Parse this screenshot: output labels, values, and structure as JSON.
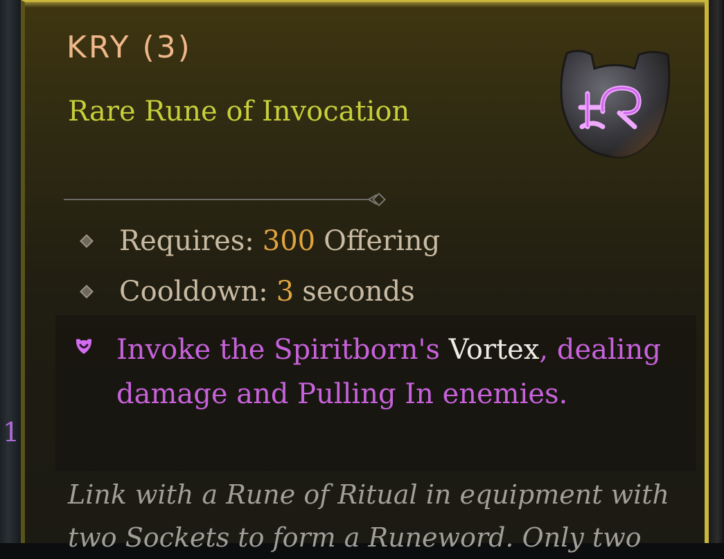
{
  "tooltip": {
    "title": "KRY (3)",
    "subtitle": "Rare Rune of Invocation",
    "icon": "rune-kry-icon",
    "requires": {
      "label": "Requires:",
      "value": "300",
      "unit": "Offering"
    },
    "cooldown": {
      "label": "Cooldown:",
      "value": "3",
      "unit": "seconds"
    },
    "effect": {
      "pre": "Invoke the Spiritborn's ",
      "highlight": "Vortex",
      "post": ", dealing damage and Pulling In enemies."
    },
    "flavor": "Link with a Rune of Ritual in equipment with two Sockets to form a Runeword. Only two"
  },
  "edge_glyph": "1",
  "colors": {
    "title": "#efb78a",
    "subtitle": "#c8cf3a",
    "number": "#e2a43e",
    "effect": "#c762db",
    "highlight": "#ecebe4",
    "border": "#c9b63a"
  }
}
